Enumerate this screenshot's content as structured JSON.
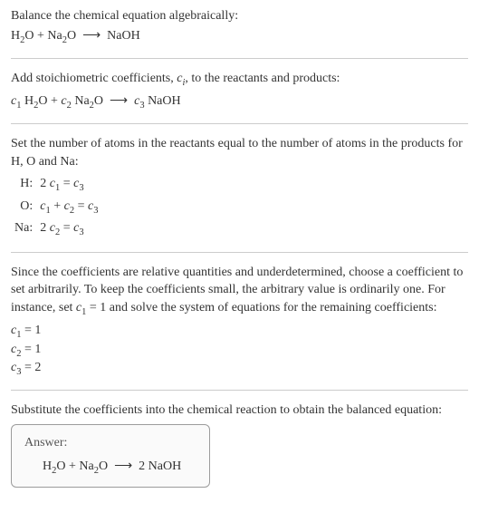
{
  "section1": {
    "title": "Balance the chemical equation algebraically:",
    "equation_html": "H<sub>2</sub>O + Na<sub>2</sub>O &nbsp;⟶&nbsp; NaOH"
  },
  "section2": {
    "title_html": "Add stoichiometric coefficients, <span class='italic'>c<sub>i</sub></span>, to the reactants and products:",
    "equation_html": "<span class='italic'>c</span><sub>1</sub> H<sub>2</sub>O + <span class='italic'>c</span><sub>2</sub> Na<sub>2</sub>O &nbsp;⟶&nbsp; <span class='italic'>c</span><sub>3</sub> NaOH"
  },
  "section3": {
    "title": "Set the number of atoms in the reactants equal to the number of atoms in the products for H, O and Na:",
    "rows": [
      {
        "elem": "H:",
        "eq_html": "2 <span class='italic'>c</span><sub>1</sub> = <span class='italic'>c</span><sub>3</sub>"
      },
      {
        "elem": "O:",
        "eq_html": "<span class='italic'>c</span><sub>1</sub> + <span class='italic'>c</span><sub>2</sub> = <span class='italic'>c</span><sub>3</sub>"
      },
      {
        "elem": "Na:",
        "eq_html": "2 <span class='italic'>c</span><sub>2</sub> = <span class='italic'>c</span><sub>3</sub>"
      }
    ]
  },
  "section4": {
    "title_html": "Since the coefficients are relative quantities and underdetermined, choose a coefficient to set arbitrarily. To keep the coefficients small, the arbitrary value is ordinarily one. For instance, set <span class='italic'>c</span><sub>1</sub> = 1 and solve the system of equations for the remaining coefficients:",
    "coeffs": [
      {
        "html": "<span class='italic'>c</span><sub>1</sub> = 1"
      },
      {
        "html": "<span class='italic'>c</span><sub>2</sub> = 1"
      },
      {
        "html": "<span class='italic'>c</span><sub>3</sub> = 2"
      }
    ]
  },
  "section5": {
    "title": "Substitute the coefficients into the chemical reaction to obtain the balanced equation:"
  },
  "answer": {
    "label": "Answer:",
    "content_html": "H<sub>2</sub>O + Na<sub>2</sub>O &nbsp;⟶&nbsp; 2 NaOH"
  }
}
